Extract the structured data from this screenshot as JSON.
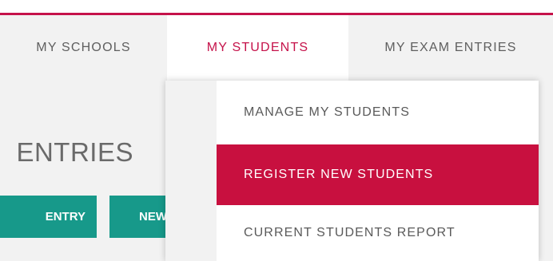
{
  "nav": {
    "items": [
      {
        "label": "MY SCHOOLS"
      },
      {
        "label": "MY STUDENTS"
      },
      {
        "label": "MY EXAM ENTRIES"
      }
    ]
  },
  "page": {
    "heading": "ENTRIES",
    "buttons": {
      "entry_label": "ENTRY",
      "new_label": "NEW"
    }
  },
  "dropdown": {
    "items": [
      {
        "label": "MANAGE MY STUDENTS"
      },
      {
        "label": "REGISTER NEW STUDENTS"
      },
      {
        "label": "CURRENT STUDENTS REPORT"
      }
    ]
  },
  "colors": {
    "accent": "#c5124a",
    "button": "#17998a",
    "background": "#f2f2f2"
  }
}
